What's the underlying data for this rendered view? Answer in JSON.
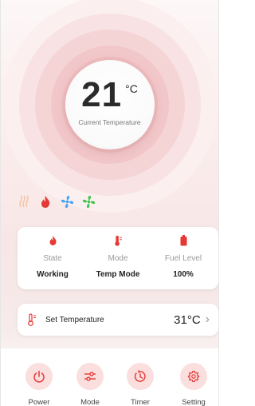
{
  "current": {
    "temperature": "21",
    "unit": "°C",
    "label": "Current Temperature"
  },
  "status": {
    "state": {
      "label": "State",
      "value": "Working"
    },
    "mode": {
      "label": "Mode",
      "value": "Temp Mode"
    },
    "fuel": {
      "label": "Fuel Level",
      "value": "100%"
    }
  },
  "set_temperature": {
    "label": "Set Temperature",
    "value": "31°C"
  },
  "bottom_nav": [
    {
      "label": "Power",
      "icon": "power-icon"
    },
    {
      "label": "Mode",
      "icon": "sliders-icon"
    },
    {
      "label": "Timer",
      "icon": "timer-icon"
    },
    {
      "label": "Setting",
      "icon": "gear-icon"
    }
  ],
  "colors": {
    "accent": "#e53935",
    "fan_blue": "#42a5f5",
    "fan_green": "#43c34a",
    "heat_muted": "#f2c6a8"
  }
}
